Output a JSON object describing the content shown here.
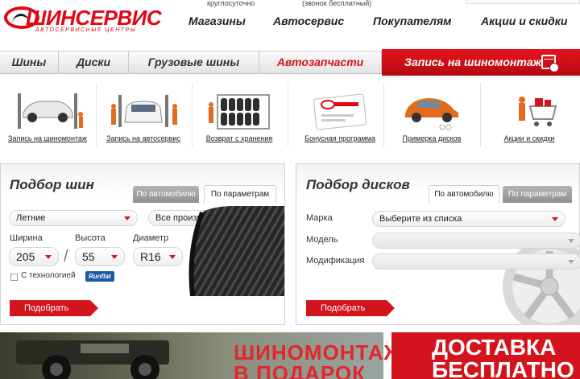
{
  "header": {
    "logo_text": "ШИНСЕРВИС",
    "logo_sub": "АВТОСЕРВИСНЫЕ ЦЕНТРЫ",
    "top_note_1": "круглосуточно",
    "top_note_2": "(звонок бесплатный)",
    "topnav": [
      "Магазины",
      "Автосервис",
      "Покупателям",
      "Акции и скидки"
    ]
  },
  "navbar": {
    "items": [
      "Шины",
      "Диски",
      "Грузовые шины",
      "Автозапчасти"
    ],
    "cta": "Запись на шиномонтаж",
    "accent": "#d4141c"
  },
  "services": [
    {
      "label": "Запись на шиномонтаж",
      "icon": "car-lift-icon"
    },
    {
      "label": "Запись на автосервис",
      "icon": "car-service-icon"
    },
    {
      "label": "Возврат с хранения",
      "icon": "tire-storage-icon"
    },
    {
      "label": "Бонусная программа",
      "icon": "bonus-card-icon"
    },
    {
      "label": "Примерка дисков",
      "icon": "car-wheels-icon"
    },
    {
      "label": "Акции и скидки",
      "icon": "shopping-cart-icon"
    }
  ],
  "tires": {
    "title": "Подбор шин",
    "tab_car": "По автомобилю",
    "tab_params": "По параметрам",
    "season": "Летние",
    "brand": "Все производители",
    "width_label": "Ширина",
    "height_label": "Высота",
    "diameter_label": "Диаметр",
    "width": "205",
    "height": "55",
    "diameter": "R16",
    "tech_label": "С технологией",
    "runflat": "Runflat",
    "submit": "Подобрать"
  },
  "discs": {
    "title": "Подбор дисков",
    "tab_car": "По автомобилю",
    "tab_params": "По параметрам",
    "make_label": "Марка",
    "model_label": "Модель",
    "mod_label": "Модификация",
    "make_value": "Выберите из списка",
    "submit": "Подобрать"
  },
  "banners": {
    "promo_1": "ШИНОМОНТАЖ",
    "promo_2": "В ПОДАРОК",
    "delivery_1": "ДОСТАВКА",
    "delivery_2": "БЕСПЛАТНО"
  }
}
